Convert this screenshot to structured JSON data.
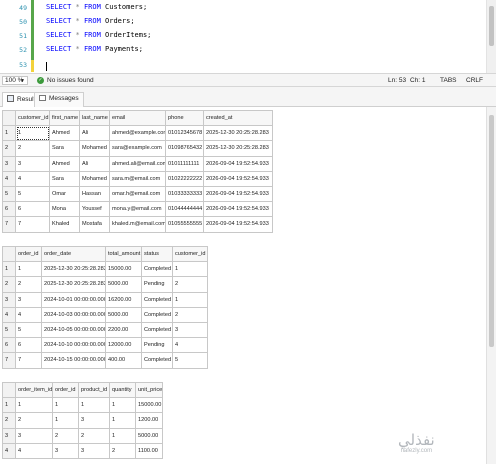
{
  "editor": {
    "line_numbers": [
      "49",
      "50",
      "51",
      "52",
      "53"
    ],
    "lines": [
      {
        "keyword": "SELECT",
        "op": "*",
        "from": "FROM",
        "table": "Customers;"
      },
      {
        "keyword": "SELECT",
        "op": "*",
        "from": "FROM",
        "table": "Orders;"
      },
      {
        "keyword": "SELECT",
        "op": "*",
        "from": "FROM",
        "table": "OrderItems;"
      },
      {
        "keyword": "SELECT",
        "op": "*",
        "from": "FROM",
        "table": "Payments;"
      }
    ]
  },
  "status_bar": {
    "zoom": "100 %",
    "check_icon": "check-circle-icon",
    "message": "No issues found",
    "ln": "Ln: 53",
    "ch": "Ch: 1",
    "tabs": "TABS",
    "crlf": "CRLF"
  },
  "tabs": [
    {
      "label": "Results",
      "icon": "grid-icon"
    },
    {
      "label": "Messages",
      "icon": "message-icon"
    }
  ],
  "customers": {
    "columns": [
      "customer_id",
      "first_name",
      "last_name",
      "email",
      "phone",
      "created_at"
    ],
    "rows": [
      [
        "1",
        "1",
        "Ahmed",
        "Ali",
        "ahmed@example.com",
        "01012345678",
        "2025-12-30 20:25:28.283"
      ],
      [
        "2",
        "2",
        "Sara",
        "Mohamed",
        "sara@example.com",
        "01098765432",
        "2025-12-30 20:25:28.283"
      ],
      [
        "3",
        "3",
        "Ahmed",
        "Ali",
        "ahmed.ali@email.com",
        "01011111111",
        "2026-09-04 19:52:54.933"
      ],
      [
        "4",
        "4",
        "Sara",
        "Mohamed",
        "sara.m@email.com",
        "01022222222",
        "2026-09-04 19:52:54.933"
      ],
      [
        "5",
        "5",
        "Omar",
        "Hassan",
        "omar.h@email.com",
        "01033333333",
        "2026-09-04 19:52:54.933"
      ],
      [
        "6",
        "6",
        "Mona",
        "Youssef",
        "mona.y@email.com",
        "01044444444",
        "2026-09-04 19:52:54.933"
      ],
      [
        "7",
        "7",
        "Khaled",
        "Mostafa",
        "khaled.m@email.com",
        "01055555555",
        "2026-09-04 19:52:54.933"
      ]
    ]
  },
  "orders": {
    "columns": [
      "order_id",
      "order_date",
      "total_amount",
      "status",
      "customer_id"
    ],
    "rows": [
      [
        "1",
        "1",
        "2025-12-30 20:25:28.283",
        "15000.00",
        "Completed",
        "1"
      ],
      [
        "2",
        "2",
        "2025-12-30 20:25:28.283",
        "5000.00",
        "Pending",
        "2"
      ],
      [
        "3",
        "3",
        "2024-10-01 00:00:00.000",
        "16200.00",
        "Completed",
        "1"
      ],
      [
        "4",
        "4",
        "2024-10-03 00:00:00.000",
        "5000.00",
        "Completed",
        "2"
      ],
      [
        "5",
        "5",
        "2024-10-05 00:00:00.000",
        "2200.00",
        "Completed",
        "3"
      ],
      [
        "6",
        "6",
        "2024-10-10 00:00:00.000",
        "12000.00",
        "Pending",
        "4"
      ],
      [
        "7",
        "7",
        "2024-10-15 00:00:00.000",
        "400.00",
        "Completed",
        "5"
      ]
    ]
  },
  "order_items": {
    "columns": [
      "order_item_id",
      "order_id",
      "product_id",
      "quantity",
      "unit_price"
    ],
    "rows": [
      [
        "1",
        "1",
        "1",
        "1",
        "1",
        "15000.00"
      ],
      [
        "2",
        "2",
        "1",
        "3",
        "1",
        "1200.00"
      ],
      [
        "3",
        "3",
        "2",
        "2",
        "1",
        "5000.00"
      ],
      [
        "4",
        "4",
        "3",
        "3",
        "2",
        "1100.00"
      ]
    ]
  },
  "watermark": {
    "arabic": "نفذلي",
    "latin": "nafezly.com"
  }
}
